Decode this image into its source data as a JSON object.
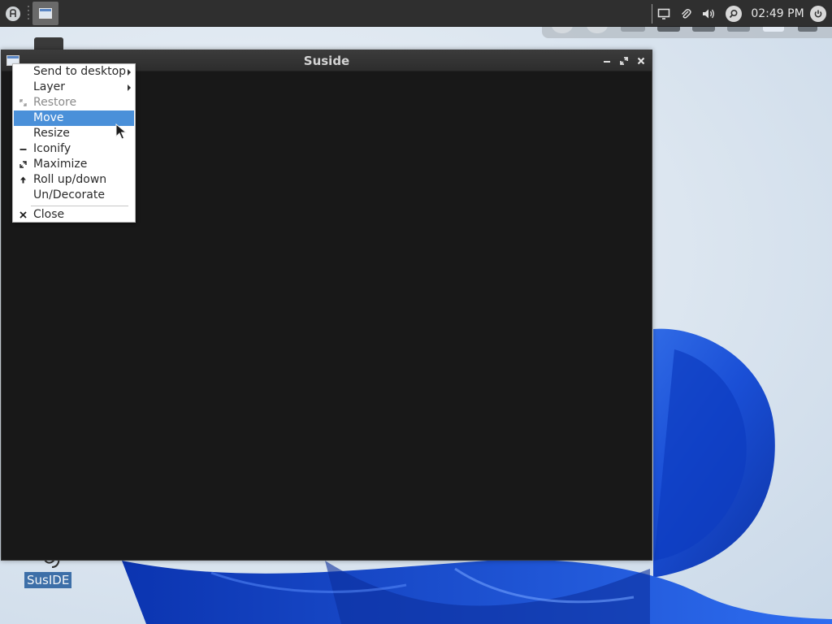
{
  "taskbar": {
    "clock": "02:49 PM"
  },
  "window": {
    "title": "Suside"
  },
  "context_menu": {
    "items": [
      {
        "label": "Send to desktop",
        "icon": "",
        "submenu": true,
        "state": "normal"
      },
      {
        "label": "Layer",
        "icon": "",
        "submenu": true,
        "state": "normal"
      },
      {
        "label": "Restore",
        "icon": "restore-icon",
        "submenu": false,
        "state": "disabled"
      },
      {
        "label": "Move",
        "icon": "",
        "submenu": false,
        "state": "active"
      },
      {
        "label": "Resize",
        "icon": "",
        "submenu": false,
        "state": "normal"
      },
      {
        "label": "Iconify",
        "icon": "iconify-icon",
        "submenu": false,
        "state": "normal"
      },
      {
        "label": "Maximize",
        "icon": "maximize-icon",
        "submenu": false,
        "state": "normal"
      },
      {
        "label": "Roll up/down",
        "icon": "roll-up-icon",
        "submenu": false,
        "state": "normal"
      },
      {
        "label": "Un/Decorate",
        "icon": "",
        "submenu": false,
        "state": "normal"
      },
      {
        "label": "Close",
        "icon": "close-icon",
        "submenu": false,
        "state": "normal"
      }
    ]
  },
  "desktop": {
    "icon_label": "SusIDE"
  },
  "colors": {
    "menu_highlight": "#4a90d9",
    "window_bg": "#181818",
    "panel_bg": "#2f2f2f",
    "wallpaper_accent": "#1a4fd6"
  }
}
